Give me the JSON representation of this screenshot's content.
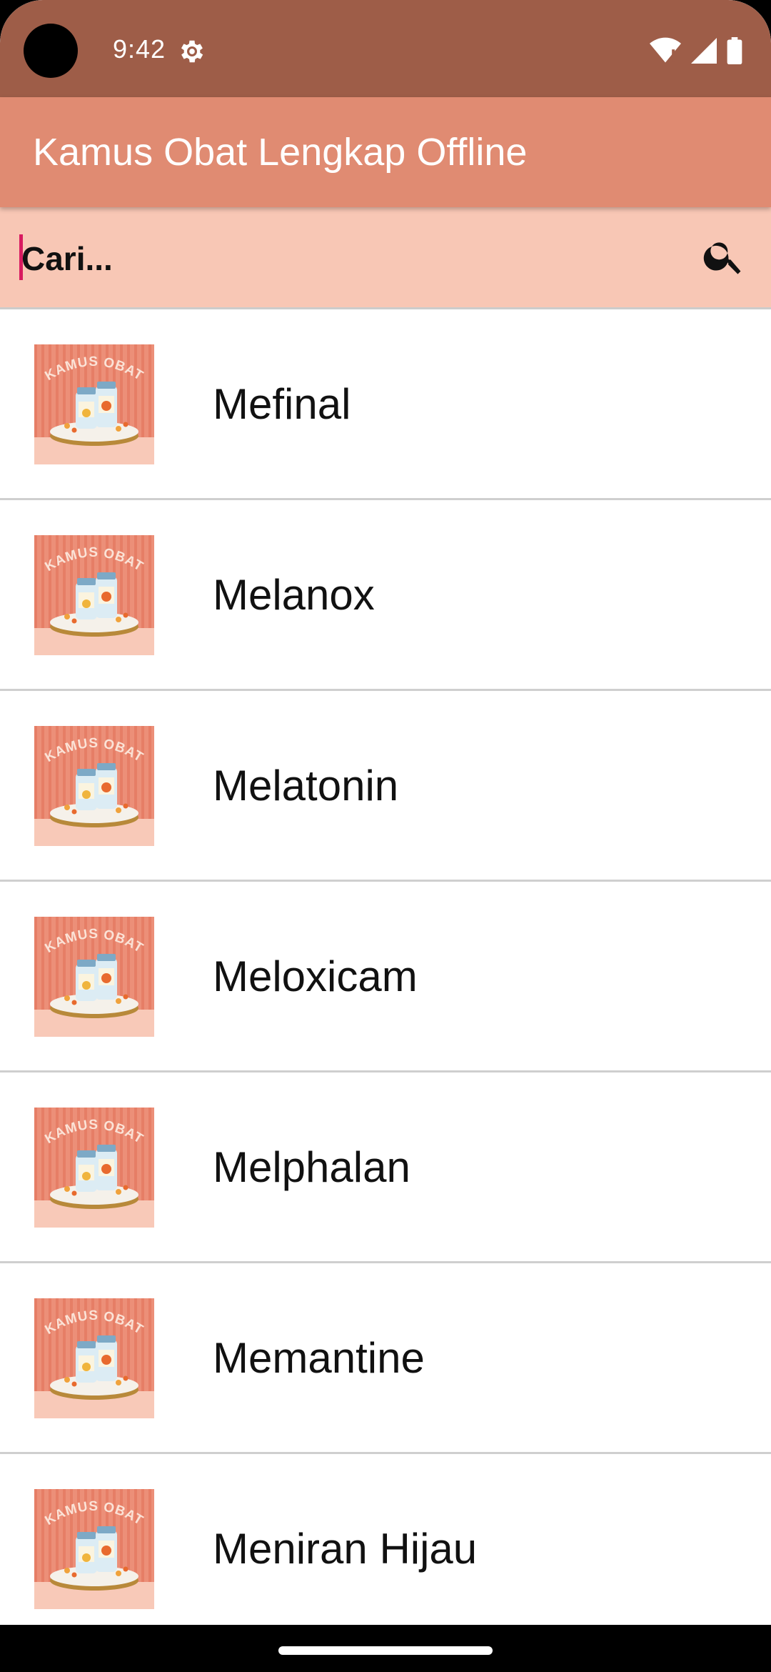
{
  "status_bar": {
    "time": "9:42",
    "icons": [
      "settings-gear-icon",
      "wifi-icon",
      "signal-icon",
      "battery-icon"
    ]
  },
  "app_bar": {
    "title": "Kamus Obat Lengkap Offline",
    "color": "#e08b72"
  },
  "search": {
    "placeholder": "Cari...",
    "value": "",
    "icon": "search-icon"
  },
  "list": {
    "thumbnail_text": "KAMUS OBAT",
    "items": [
      {
        "label": "Mefinal"
      },
      {
        "label": "Melanox"
      },
      {
        "label": "Melatonin"
      },
      {
        "label": "Meloxicam"
      },
      {
        "label": "Melphalan"
      },
      {
        "label": "Memantine"
      },
      {
        "label": "Meniran Hijau"
      }
    ]
  },
  "colors": {
    "status_bar": "#9e5d48",
    "app_bar": "#e08b72",
    "search_bar": "#f8c7b5",
    "cursor": "#d81b60"
  }
}
